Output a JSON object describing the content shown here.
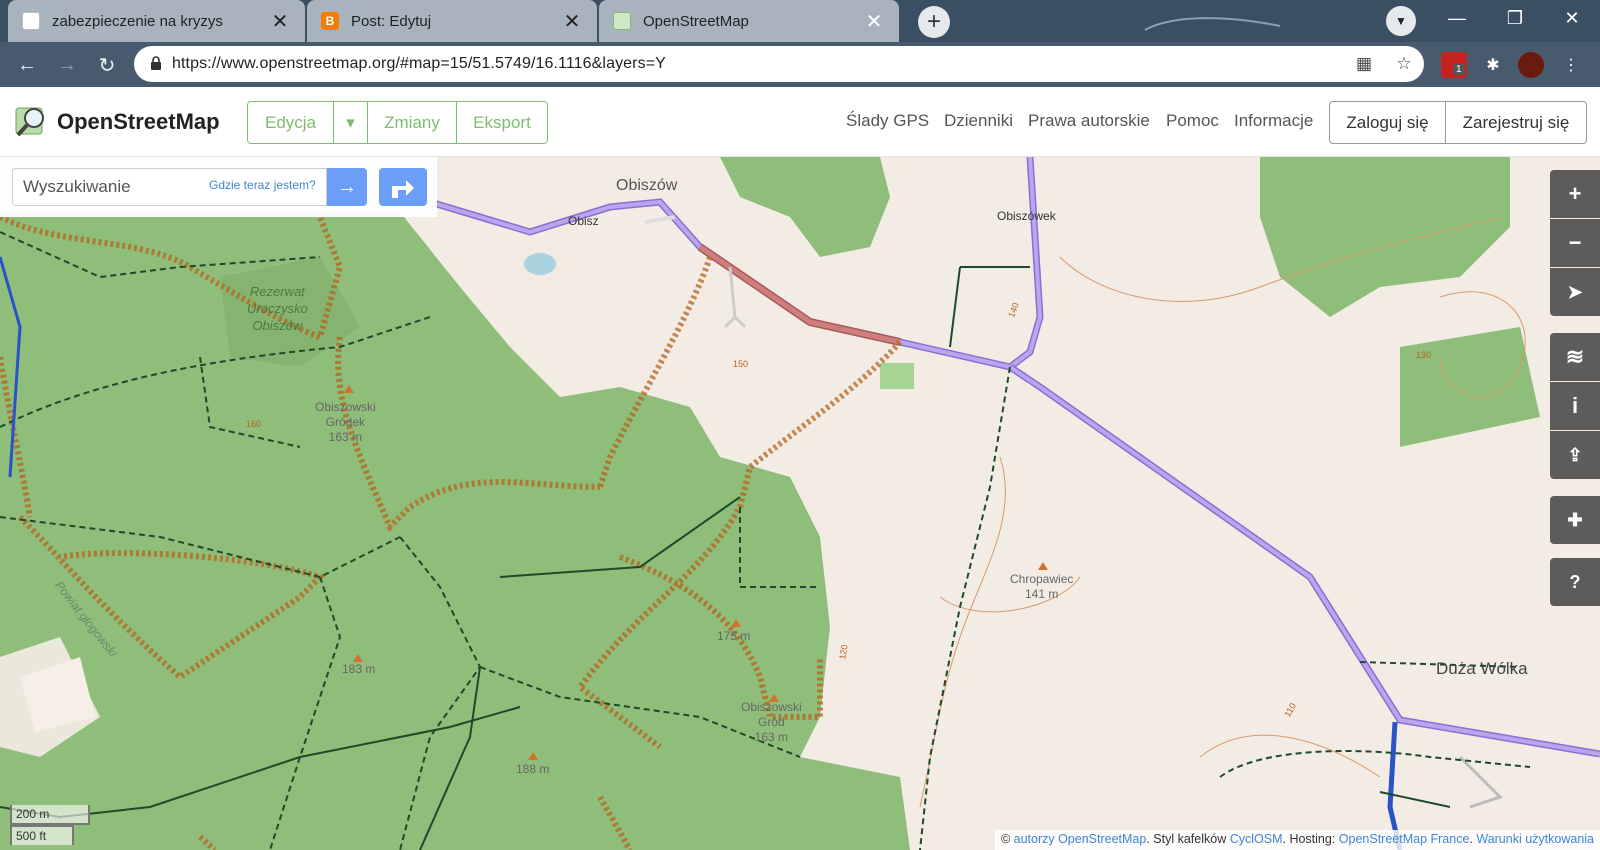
{
  "browser": {
    "tabs": [
      {
        "title": "zabezpieczenie na kryzys",
        "close": "✕",
        "icon": "moon-icon"
      },
      {
        "title": "Post: Edytuj",
        "close": "✕",
        "icon": "blogger-icon"
      },
      {
        "title": "OpenStreetMap",
        "close": "✕",
        "icon": "osm-icon"
      }
    ],
    "new_tab": "+",
    "url": "https://www.openstreetmap.org/#map=15/51.5749/16.1116&layers=Y",
    "extension_badge": "1",
    "window_controls": {
      "minimize": "—",
      "restore": "❐",
      "close": "✕"
    }
  },
  "osm": {
    "brand": "OpenStreetMap",
    "edit_group": {
      "edit": "Edycja",
      "dropdown": "▾",
      "changes": "Zmiany",
      "export": "Eksport"
    },
    "nav": [
      "Ślady GPS",
      "Dzienniki",
      "Prawa autorskie",
      "Pomoc",
      "Informacje"
    ],
    "login": "Zaloguj się",
    "register": "Zarejestruj się",
    "search": {
      "placeholder": "Wyszukiwanie",
      "where_am_i": "Gdzie teraz jestem?",
      "go": "→"
    }
  },
  "map": {
    "labels": {
      "obiszow": "Obiszów",
      "obisz": "Obisz",
      "obiszowek": "Obiszówek",
      "rezerwat": "Rezerwat\nUroczysko\nObiszów",
      "grodek": "Obiszowski\nGródek\n163 m",
      "chropawiec": "Chropawiec\n141 m",
      "duza_wolka": "Duża Wólka",
      "h175": "175 m",
      "h183": "183 m",
      "h188": "188 m",
      "grod": "Obiszowski\nGród\n163 m",
      "powiat": "Powiat głogowski",
      "c140a": "140",
      "c140b": "140",
      "c150": "150",
      "c160": "160",
      "c130": "130",
      "c110": "110",
      "c120": "120"
    },
    "controls": {
      "zoom_in": "+",
      "zoom_out": "−",
      "locate": "➤",
      "layers": "≋",
      "info": "i",
      "share": "⇪",
      "note": "✚",
      "query": "?"
    },
    "scale": {
      "metric": "200 m",
      "imperial": "500 ft"
    },
    "attribution": {
      "prefix": "© ",
      "authors": "autorzy OpenStreetMap",
      "style_text": ". Styl kafelków ",
      "cyclosm": "CyclOSM",
      "hosting_text": ". Hosting: ",
      "osmfr": "OpenStreetMap France",
      "sep": ". ",
      "terms": "Warunki użytkowania"
    }
  },
  "colors": {
    "osm_green": "#7ebc6f",
    "forest": "#8fbd7a",
    "primary_road": "#b19ce6",
    "tertiary_red": "#c46e6e",
    "path_brown": "#b5651d",
    "track_dark": "#1e4a2a",
    "accent_blue": "#6b9ef6"
  }
}
